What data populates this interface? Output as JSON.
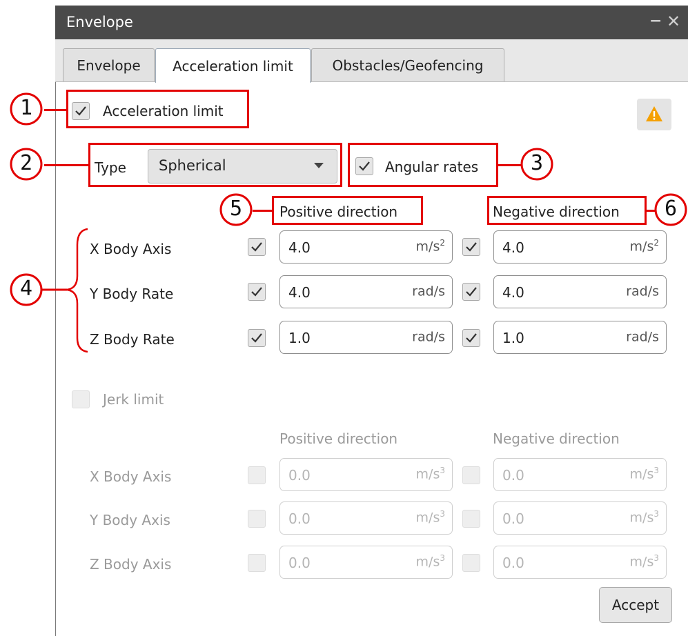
{
  "window": {
    "title": "Envelope",
    "minimize_glyph": "−",
    "close_glyph": "✕"
  },
  "tabs": [
    {
      "label": "Envelope",
      "active": false
    },
    {
      "label": "Acceleration limit",
      "active": true
    },
    {
      "label": "Obstacles/Geofencing",
      "active": false
    }
  ],
  "acceleration": {
    "enabled_label": "Acceleration limit",
    "enabled": true,
    "type_label": "Type",
    "type_value": "Spherical",
    "angular_rates_label": "Angular rates",
    "angular_rates": true,
    "positive_header": "Positive direction",
    "negative_header": "Negative direction",
    "rows": [
      {
        "label": "X Body Axis",
        "pos_checked": true,
        "pos_value": "4.0",
        "pos_unit": "m/s",
        "pos_exp": "2",
        "neg_checked": true,
        "neg_value": "4.0",
        "neg_unit": "m/s",
        "neg_exp": "2"
      },
      {
        "label": "Y Body Rate",
        "pos_checked": true,
        "pos_value": "4.0",
        "pos_unit": "rad/s",
        "pos_exp": "",
        "neg_checked": true,
        "neg_value": "4.0",
        "neg_unit": "rad/s",
        "neg_exp": ""
      },
      {
        "label": "Z Body Rate",
        "pos_checked": true,
        "pos_value": "1.0",
        "pos_unit": "rad/s",
        "pos_exp": "",
        "neg_checked": true,
        "neg_value": "1.0",
        "neg_unit": "rad/s",
        "neg_exp": ""
      }
    ]
  },
  "jerk": {
    "enabled_label": "Jerk limit",
    "enabled": false,
    "positive_header": "Positive direction",
    "negative_header": "Negative direction",
    "rows": [
      {
        "label": "X Body Axis",
        "pos_value": "0.0",
        "pos_unit": "m/s",
        "pos_exp": "3",
        "neg_value": "0.0",
        "neg_unit": "m/s",
        "neg_exp": "3"
      },
      {
        "label": "Y Body Axis",
        "pos_value": "0.0",
        "pos_unit": "m/s",
        "pos_exp": "3",
        "neg_value": "0.0",
        "neg_unit": "m/s",
        "neg_exp": "3"
      },
      {
        "label": "Z Body Axis",
        "pos_value": "0.0",
        "pos_unit": "m/s",
        "pos_exp": "3",
        "neg_value": "0.0",
        "neg_unit": "m/s",
        "neg_exp": "3"
      }
    ]
  },
  "accept_label": "Accept",
  "warning_icon": "warning-triangle-icon",
  "callouts": [
    "1",
    "2",
    "3",
    "4",
    "5",
    "6"
  ],
  "colors": {
    "annotation": "#e30000",
    "warning": "#f5a000",
    "titlebar": "#4a4a4a"
  }
}
